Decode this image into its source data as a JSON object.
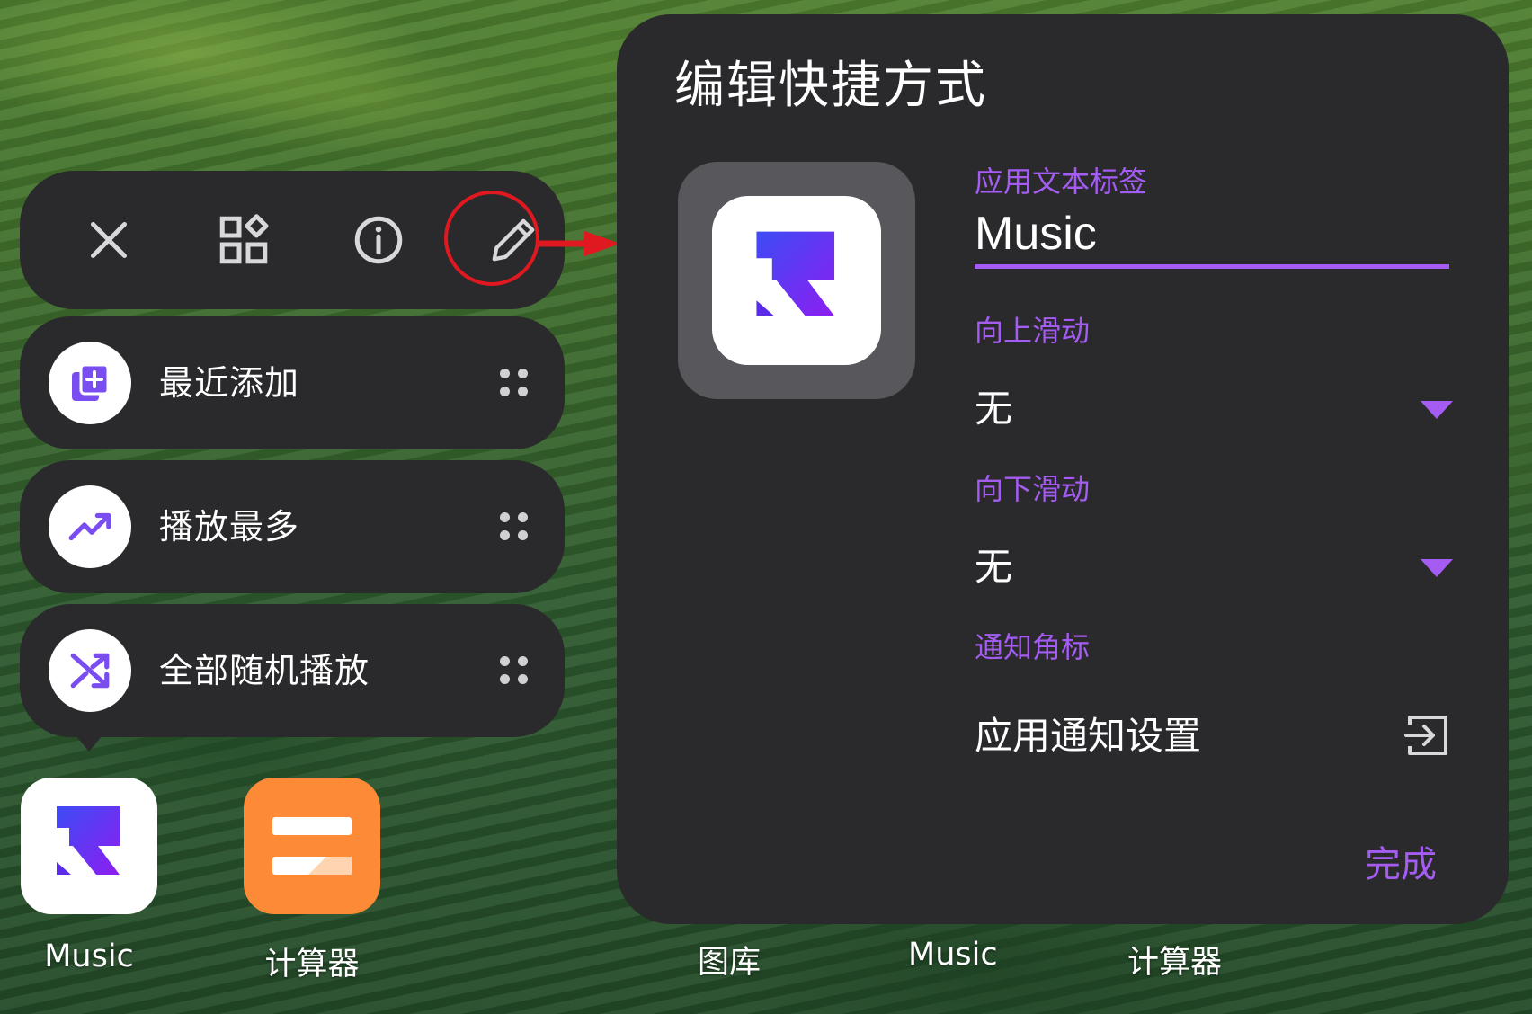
{
  "colors": {
    "accent": "#a55cf2",
    "panel": "#2a2a2c",
    "highlight": "#e01820",
    "calculator": "#fd8a37"
  },
  "toolbar": {
    "close_icon": "close-icon",
    "widgets_icon": "widgets-icon",
    "info_icon": "info-icon",
    "edit_icon": "pencil-icon"
  },
  "shortcuts": [
    {
      "label": "最近添加",
      "icon": "playlist-add-icon"
    },
    {
      "label": "播放最多",
      "icon": "trending-up-icon"
    },
    {
      "label": "全部随机播放",
      "icon": "shuffle-icon"
    }
  ],
  "home_apps": [
    {
      "label": "Music",
      "icon": "music-app-icon"
    },
    {
      "label": "计算器",
      "icon": "calculator-app-icon"
    }
  ],
  "dialog": {
    "title": "编辑快捷方式",
    "label_field": {
      "label": "应用文本标签",
      "value": "Music"
    },
    "swipe_up": {
      "label": "向上滑动",
      "value": "无"
    },
    "swipe_down": {
      "label": "向下滑动",
      "value": "无"
    },
    "badge": {
      "label": "通知角标",
      "value": "应用通知设置"
    },
    "done": "完成"
  },
  "dock": [
    "图库",
    "Music",
    "计算器"
  ]
}
